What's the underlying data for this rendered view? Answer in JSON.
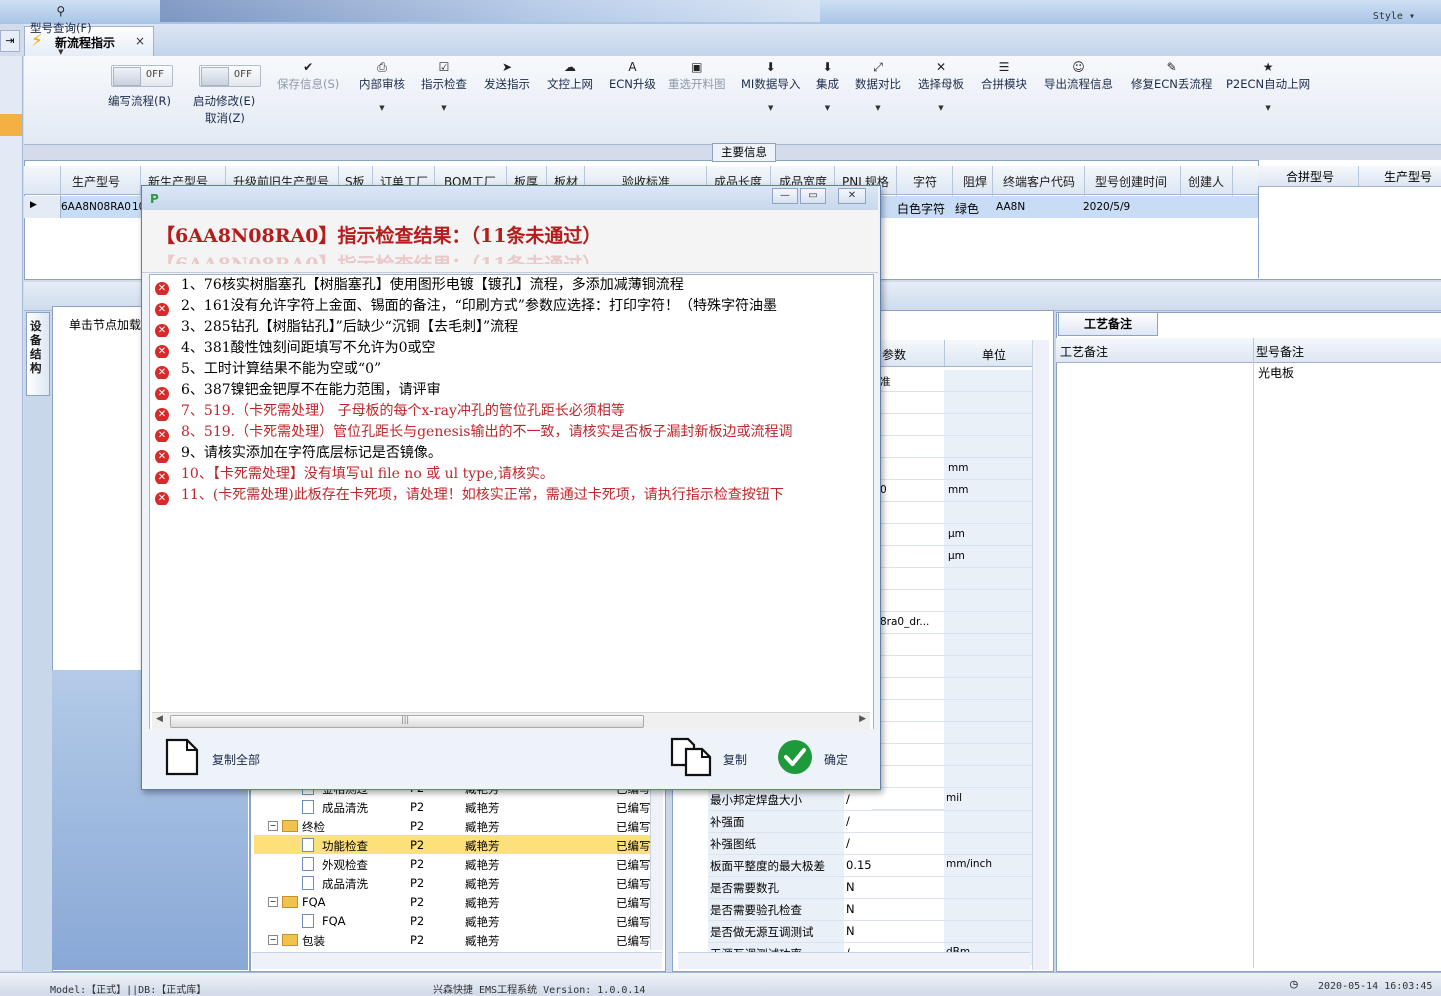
{
  "topbar": {
    "style_label": "Style ▾",
    "restore_icon": "restore-window-icon"
  },
  "tab": {
    "title": "新流程指示",
    "close": "×"
  },
  "ribbon": {
    "query": "型号查询(F)",
    "edit_flow": "编写流程(R)",
    "start_modify": "启动修改(E)",
    "cancel": "取消(Z)",
    "switch_off": "OFF",
    "buttons": [
      {
        "label": "保存信息(S)",
        "icon": "✔",
        "disabled": true
      },
      {
        "label": "内部审核",
        "icon": "⎙",
        "dropdown": true
      },
      {
        "label": "指示检查",
        "icon": "☑",
        "dropdown": true
      },
      {
        "label": "发送指示",
        "icon": "➤"
      },
      {
        "label": "文控上网",
        "icon": "☁"
      },
      {
        "label": "ECN升级",
        "icon": "A"
      },
      {
        "label": "重选开料图",
        "icon": "▣",
        "disabled": true
      },
      {
        "label": "MI数据导入",
        "icon": "⬇",
        "dropdown": true
      },
      {
        "label": "集成",
        "icon": "⬇",
        "dropdown": true
      },
      {
        "label": "数据对比",
        "icon": "⤢",
        "dropdown": true
      },
      {
        "label": "选择母板",
        "icon": "✕",
        "dropdown": true
      },
      {
        "label": "合拼模块",
        "icon": "☰"
      },
      {
        "label": "导出流程信息",
        "icon": "☺"
      },
      {
        "label": "修复ECN丢流程",
        "icon": "✎"
      },
      {
        "label": "P2ECN自动上网",
        "icon": "★",
        "dropdown": true
      }
    ]
  },
  "main_info": {
    "title": "主要信息",
    "columns": [
      "生产型号",
      "新生产型号",
      "升级前旧生产型号",
      "S板",
      "订单工厂",
      "BOM工厂",
      "板厚",
      "板材",
      "验收标准",
      "成品长度",
      "成品宽度",
      "PNL规格",
      "字符",
      "阻焊",
      "终端客户代码",
      "型号创建时间",
      "创建人"
    ],
    "row": {
      "production_model": "6AA8N08RA0",
      "new_model_partial": "10",
      "character": "白色字符",
      "solder_mask": "绿色",
      "customer_code": "AA8N",
      "created": "2020/5/9"
    },
    "merge_columns": [
      "合拼型号",
      "生产型号"
    ]
  },
  "lower": {
    "vertical_tab": "设备结构",
    "tree_header": "单击节点加载",
    "process_rows": [
      {
        "name": "金相测过",
        "p": "P2",
        "person": "臧艳芳",
        "status": "已编写",
        "level": 2,
        "type": "doc"
      },
      {
        "name": "成品清洗",
        "p": "P2",
        "person": "臧艳芳",
        "status": "已编写",
        "level": 2,
        "type": "doc"
      },
      {
        "name": "终检",
        "p": "P2",
        "person": "臧艳芳",
        "status": "已编写",
        "level": 1,
        "type": "folder"
      },
      {
        "name": "功能检查",
        "p": "P2",
        "person": "臧艳芳",
        "status": "已编写",
        "level": 2,
        "type": "doc",
        "selected": true
      },
      {
        "name": "外观检查",
        "p": "P2",
        "person": "臧艳芳",
        "status": "已编写",
        "level": 2,
        "type": "doc"
      },
      {
        "name": "成品清洗",
        "p": "P2",
        "person": "臧艳芳",
        "status": "已编写",
        "level": 2,
        "type": "doc"
      },
      {
        "name": "FQA",
        "p": "P2",
        "person": "臧艳芳",
        "status": "已编写",
        "level": 1,
        "type": "folder"
      },
      {
        "name": "FQA",
        "p": "P2",
        "person": "臧艳芳",
        "status": "已编写",
        "level": 2,
        "type": "doc"
      },
      {
        "name": "包装",
        "p": "P2",
        "person": "臧艳芳",
        "status": "已编写",
        "level": 1,
        "type": "folder"
      }
    ],
    "param_headers": {
      "param": "参数",
      "unit": "单位"
    },
    "param_right_peeks": [
      {
        "v": "准",
        "u": ""
      },
      {
        "v": "",
        "u": ""
      },
      {
        "v": "",
        "u": ""
      },
      {
        "v": "",
        "u": ""
      },
      {
        "v": "",
        "u": "mm"
      },
      {
        "v": "0",
        "u": "mm"
      },
      {
        "v": "",
        "u": ""
      },
      {
        "v": "",
        "u": "μm"
      },
      {
        "v": "",
        "u": "μm"
      },
      {
        "v": "",
        "u": ""
      },
      {
        "v": "",
        "u": ""
      },
      {
        "v": "8ra0_dr...",
        "u": ""
      }
    ],
    "param_rows": [
      {
        "name": "最小邦定焊盘大小",
        "value": "/",
        "unit": "mil"
      },
      {
        "name": "补强面",
        "value": "/",
        "unit": ""
      },
      {
        "name": "补强图纸",
        "value": "/",
        "unit": ""
      },
      {
        "name": "板面平整度的最大极差",
        "value": "0.15",
        "unit": "mm/inch"
      },
      {
        "name": "是否需要数孔",
        "value": "N",
        "unit": ""
      },
      {
        "name": "是否需要验孔检查",
        "value": "N",
        "unit": ""
      },
      {
        "name": "是否做无源互调测试",
        "value": "N",
        "unit": ""
      },
      {
        "name": "无源互调测试功率",
        "value": "/",
        "unit": "dBm"
      }
    ],
    "right_tab": "工艺备注",
    "right_columns": [
      "工艺备注",
      "型号备注"
    ],
    "right_value": "光电板"
  },
  "status": {
    "left": "Model:【正式】||DB:【正式库】",
    "center": "兴森快捷 EMS工程系统 Version: 1.0.0.14",
    "time": "2020-05-14 16:03:45"
  },
  "dialog": {
    "heading": "【6AA8N08RA0】指示检查结果：（11条未通过）",
    "ghost": "【6AA8N08RA0】指示检查结果：（11条未通过）",
    "messages": [
      {
        "text": "1、76核实树脂塞孔【树脂塞孔】使用图形电镀【镀孔】流程，多添加减薄铜流程",
        "red": false
      },
      {
        "text": "2、161没有允许字符上金面、锡面的备注，“印刷方式”参数应选择：打印字符！（特殊字符油墨",
        "red": false
      },
      {
        "text": "3、285钻孔【树脂钻孔】”后缺少“沉铜【去毛刺】”流程",
        "red": false
      },
      {
        "text": "4、381酸性蚀刻间距填写不允许为0或空",
        "red": false
      },
      {
        "text": "5、工时计算结果不能为空或“0”",
        "red": false
      },
      {
        "text": "6、387镍钯金钯厚不在能力范围，请评审",
        "red": false
      },
      {
        "text": "7、519.（卡死需处理）  子母板的每个x-ray冲孔的管位孔距长必须相等",
        "red": true
      },
      {
        "text": "8、519.（卡死需处理）管位孔距长与genesis输出的不一致，请核实是否板子漏封新板边或流程调",
        "red": true
      },
      {
        "text": "9、请核实添加在字符底层标记是否镜像。",
        "red": false
      },
      {
        "text": "10、【卡死需处理】没有填写ul file no 或 ul type,请核实。",
        "red": true
      },
      {
        "text": "11、(卡死需处理)此板存在卡死项，请处理！如核实正常，需通过卡死项，请执行指示检查按钮下",
        "red": true
      }
    ],
    "copy_all": "复制全部",
    "copy": "复制",
    "ok": "确定"
  }
}
